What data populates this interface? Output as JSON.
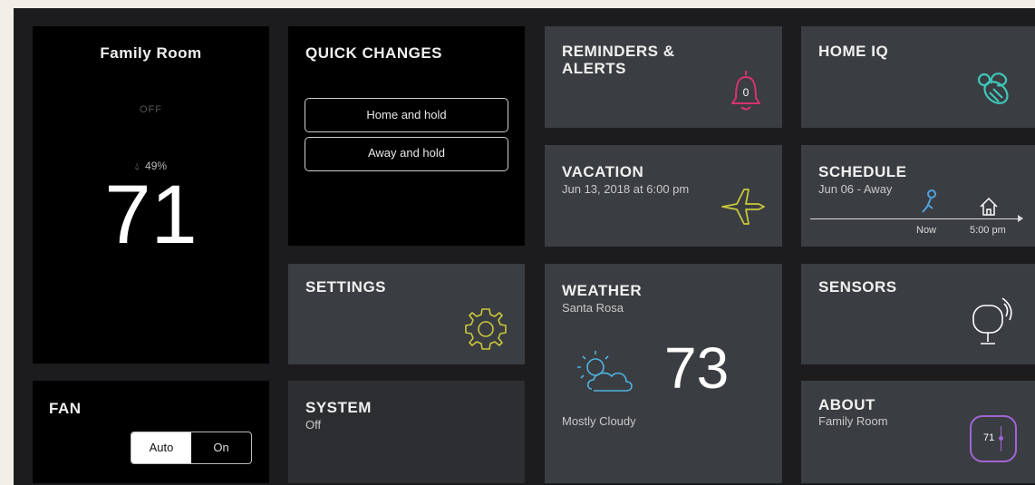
{
  "family_room": {
    "title": "Family Room",
    "mode": "OFF",
    "humidity": "⁨⁩ 49%",
    "temperature": "71"
  },
  "quick_changes": {
    "title": "QUICK CHANGES",
    "home_and_hold": "Home and hold",
    "away_and_hold": "Away and hold"
  },
  "reminders": {
    "title_line1": "REMINDERS &",
    "title_line2": "ALERTS",
    "count": "0"
  },
  "home_iq": {
    "title": "HOME IQ"
  },
  "vacation": {
    "title": "VACATION",
    "date": "Jun 13, 2018 at 6:00 pm"
  },
  "schedule": {
    "title": "SCHEDULE",
    "subtitle": "Jun 06 - Away",
    "now_label": "Now",
    "time_label": "5:00 pm"
  },
  "settings": {
    "title": "SETTINGS"
  },
  "weather": {
    "title": "WEATHER",
    "location": "Santa Rosa",
    "temperature": "73",
    "condition": "Mostly Cloudy"
  },
  "sensors": {
    "title": "SENSORS"
  },
  "fan": {
    "title": "FAN",
    "auto_label": "Auto",
    "on_label": "On",
    "selected": "Auto"
  },
  "system": {
    "title": "SYSTEM",
    "status": "Off"
  },
  "about": {
    "title": "ABOUT",
    "subtitle": "Family Room",
    "thermostat_value": "71"
  },
  "colors": {
    "bell": "#d8336f",
    "bee": "#3fc7b9",
    "plane": "#c9c93a",
    "gear": "#c9c93a",
    "person": "#4fa3e0",
    "weather_icon": "#4fb3e0",
    "about_icon": "#a066d6"
  }
}
